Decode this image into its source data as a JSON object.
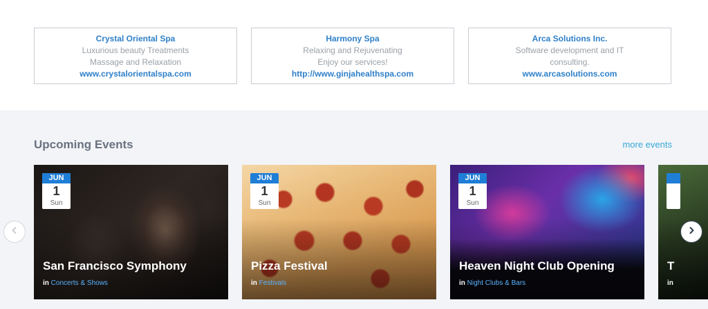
{
  "ads": [
    {
      "title": "Crystal Oriental Spa",
      "lines": [
        "Luxurious beauty Treatments",
        "Massage and Relaxation"
      ],
      "link": "www.crystalorientalspa.com"
    },
    {
      "title": "Harmony Spa",
      "lines": [
        "Relaxing and Rejuvenating",
        "Enjoy our services!"
      ],
      "link": "http://www.ginjahealthspa.com"
    },
    {
      "title": "Arca Solutions Inc.",
      "lines": [
        "Software development and IT",
        "consulting."
      ],
      "link": "www.arcasolutions.com"
    }
  ],
  "events": {
    "heading": "Upcoming Events",
    "more_label": "more events",
    "in_label": "in",
    "cards": [
      {
        "month": "JUN",
        "day": "1",
        "dow": "Sun",
        "title": "San Francisco Symphony",
        "category": "Concerts & Shows"
      },
      {
        "month": "JUN",
        "day": "1",
        "dow": "Sun",
        "title": "Pizza Festival",
        "category": "Festivals"
      },
      {
        "month": "JUN",
        "day": "1",
        "dow": "Sun",
        "title": "Heaven Night Club Opening",
        "category": "Night Clubs & Bars"
      },
      {
        "month": "",
        "day": "",
        "dow": "",
        "title": "T",
        "category": ""
      }
    ]
  },
  "icons": {
    "prev": "chevron-left-icon",
    "next": "chevron-right-icon"
  },
  "colors": {
    "link": "#2f80c9",
    "accent": "#35a7d9",
    "date_month": "#1f7ed6"
  }
}
